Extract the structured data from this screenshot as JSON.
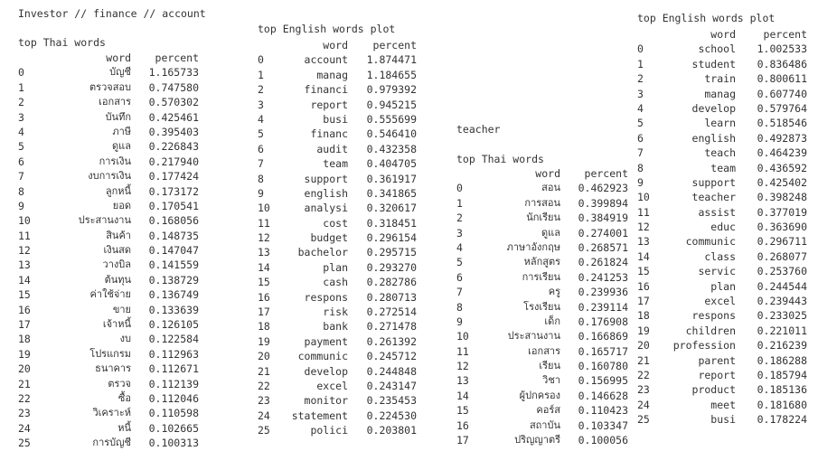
{
  "header_title": "Investor // finance // account",
  "investor_thai": {
    "title": "top Thai words",
    "columns": [
      "word",
      "percent"
    ],
    "rows": [
      [
        "0",
        "บัญชี",
        "1.165733"
      ],
      [
        "1",
        "ตรวจสอบ",
        "0.747580"
      ],
      [
        "2",
        "เอกสาร",
        "0.570302"
      ],
      [
        "3",
        "บันทึก",
        "0.425461"
      ],
      [
        "4",
        "ภาษี",
        "0.395403"
      ],
      [
        "5",
        "ดูแล",
        "0.226843"
      ],
      [
        "6",
        "การเงิน",
        "0.217940"
      ],
      [
        "7",
        "งบการเงิน",
        "0.177424"
      ],
      [
        "8",
        "ลูกหนี้",
        "0.173172"
      ],
      [
        "9",
        "ยอด",
        "0.170541"
      ],
      [
        "10",
        "ประสานงาน",
        "0.168056"
      ],
      [
        "11",
        "สินค้า",
        "0.148735"
      ],
      [
        "12",
        "เงินสด",
        "0.147047"
      ],
      [
        "13",
        "วางบิล",
        "0.141559"
      ],
      [
        "14",
        "ต้นทุน",
        "0.138729"
      ],
      [
        "15",
        "ค่าใช้จ่าย",
        "0.136749"
      ],
      [
        "16",
        "ขาย",
        "0.133639"
      ],
      [
        "17",
        "เจ้าหนี้",
        "0.126105"
      ],
      [
        "18",
        "งบ",
        "0.122584"
      ],
      [
        "19",
        "โปรแกรม",
        "0.112963"
      ],
      [
        "20",
        "ธนาคาร",
        "0.112671"
      ],
      [
        "21",
        "ตรวจ",
        "0.112139"
      ],
      [
        "22",
        "ซื้อ",
        "0.112046"
      ],
      [
        "23",
        "วิเคราะห์",
        "0.110598"
      ],
      [
        "24",
        "หนี้",
        "0.102665"
      ],
      [
        "25",
        "การบัญชี",
        "0.100313"
      ]
    ]
  },
  "investor_english": {
    "title": "top English words plot",
    "columns": [
      "word",
      "percent"
    ],
    "rows": [
      [
        "0",
        "account",
        "1.874471"
      ],
      [
        "1",
        "manag",
        "1.184655"
      ],
      [
        "2",
        "financi",
        "0.979392"
      ],
      [
        "3",
        "report",
        "0.945215"
      ],
      [
        "4",
        "busi",
        "0.555699"
      ],
      [
        "5",
        "financ",
        "0.546410"
      ],
      [
        "6",
        "audit",
        "0.432358"
      ],
      [
        "7",
        "team",
        "0.404705"
      ],
      [
        "8",
        "support",
        "0.361917"
      ],
      [
        "9",
        "english",
        "0.341865"
      ],
      [
        "10",
        "analysi",
        "0.320617"
      ],
      [
        "11",
        "cost",
        "0.318451"
      ],
      [
        "12",
        "budget",
        "0.296154"
      ],
      [
        "13",
        "bachelor",
        "0.295715"
      ],
      [
        "14",
        "plan",
        "0.293270"
      ],
      [
        "15",
        "cash",
        "0.282786"
      ],
      [
        "16",
        "respons",
        "0.280713"
      ],
      [
        "17",
        "risk",
        "0.272514"
      ],
      [
        "18",
        "bank",
        "0.271478"
      ],
      [
        "19",
        "payment",
        "0.261392"
      ],
      [
        "20",
        "communic",
        "0.245712"
      ],
      [
        "21",
        "develop",
        "0.244848"
      ],
      [
        "22",
        "excel",
        "0.243147"
      ],
      [
        "23",
        "monitor",
        "0.235453"
      ],
      [
        "24",
        "statement",
        "0.224530"
      ],
      [
        "25",
        "polici",
        "0.203801"
      ]
    ]
  },
  "teacher_label": "teacher",
  "teacher_thai": {
    "title": "top Thai words",
    "columns": [
      "word",
      "percent"
    ],
    "rows": [
      [
        "0",
        "สอน",
        "0.462923"
      ],
      [
        "1",
        "การสอน",
        "0.399894"
      ],
      [
        "2",
        "นักเรียน",
        "0.384919"
      ],
      [
        "3",
        "ดูแล",
        "0.274001"
      ],
      [
        "4",
        "ภาษาอังกฤษ",
        "0.268571"
      ],
      [
        "5",
        "หลักสูตร",
        "0.261824"
      ],
      [
        "6",
        "การเรียน",
        "0.241253"
      ],
      [
        "7",
        "ครู",
        "0.239936"
      ],
      [
        "8",
        "โรงเรียน",
        "0.239114"
      ],
      [
        "9",
        "เด็ก",
        "0.176908"
      ],
      [
        "10",
        "ประสานงาน",
        "0.166869"
      ],
      [
        "11",
        "เอกสาร",
        "0.165717"
      ],
      [
        "12",
        "เรียน",
        "0.160780"
      ],
      [
        "13",
        "วิชา",
        "0.156995"
      ],
      [
        "14",
        "ผู้ปกครอง",
        "0.146628"
      ],
      [
        "15",
        "คอร์ส",
        "0.110423"
      ],
      [
        "16",
        "สถาบัน",
        "0.103347"
      ],
      [
        "17",
        "ปริญญาตรี",
        "0.100056"
      ]
    ]
  },
  "teacher_english": {
    "title": "top English words plot",
    "columns": [
      "word",
      "percent"
    ],
    "rows": [
      [
        "0",
        "school",
        "1.002533"
      ],
      [
        "1",
        "student",
        "0.836486"
      ],
      [
        "2",
        "train",
        "0.800611"
      ],
      [
        "3",
        "manag",
        "0.607740"
      ],
      [
        "4",
        "develop",
        "0.579764"
      ],
      [
        "5",
        "learn",
        "0.518546"
      ],
      [
        "6",
        "english",
        "0.492873"
      ],
      [
        "7",
        "teach",
        "0.464239"
      ],
      [
        "8",
        "team",
        "0.436592"
      ],
      [
        "9",
        "support",
        "0.425402"
      ],
      [
        "10",
        "teacher",
        "0.398248"
      ],
      [
        "11",
        "assist",
        "0.377019"
      ],
      [
        "12",
        "educ",
        "0.363690"
      ],
      [
        "13",
        "communic",
        "0.296711"
      ],
      [
        "14",
        "class",
        "0.268077"
      ],
      [
        "15",
        "servic",
        "0.253760"
      ],
      [
        "16",
        "plan",
        "0.244544"
      ],
      [
        "17",
        "excel",
        "0.239443"
      ],
      [
        "18",
        "respons",
        "0.233025"
      ],
      [
        "19",
        "children",
        "0.221011"
      ],
      [
        "20",
        "profession",
        "0.216239"
      ],
      [
        "21",
        "parent",
        "0.186288"
      ],
      [
        "22",
        "report",
        "0.185794"
      ],
      [
        "23",
        "product",
        "0.185136"
      ],
      [
        "24",
        "meet",
        "0.181680"
      ],
      [
        "25",
        "busi",
        "0.178224"
      ]
    ]
  }
}
